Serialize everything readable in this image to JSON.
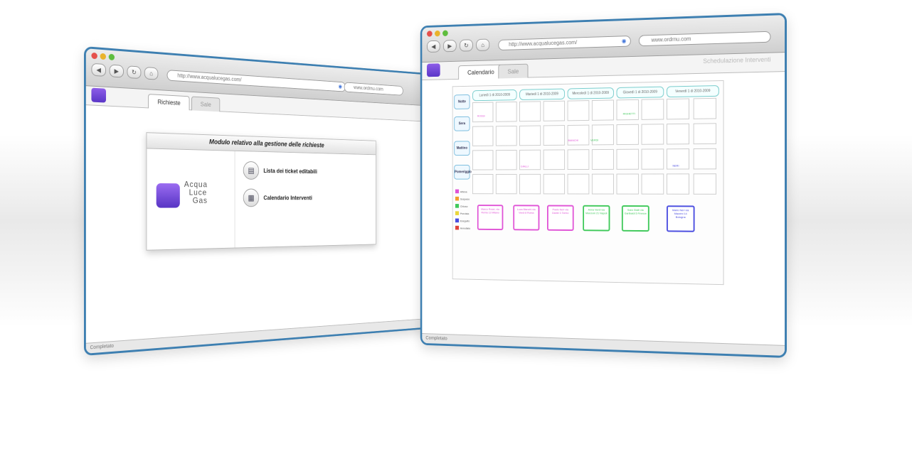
{
  "left_window": {
    "url": "http://www.acqualucegas.com/",
    "search": "www.ordrnu.com",
    "tabs": [
      "Richieste",
      "Sale"
    ],
    "card_title": "Modulo relativo alla gestione delle richieste",
    "brand_lines": [
      "Acqua",
      "Luce",
      "Gas"
    ],
    "menu": [
      {
        "label": "Lista dei ticket editabili",
        "icon": "list-icon"
      },
      {
        "label": "Calendario Interventi",
        "icon": "calendar-icon"
      }
    ],
    "status": "Completato"
  },
  "right_window": {
    "url": "http://www.acqualucegas.com/",
    "search": "www.ordrnu.com",
    "tabs": [
      "Calendario",
      "Sale"
    ],
    "header_title": "Schedulazione Interventi",
    "day_headers": [
      "Lunedì 1 di 2010-2009",
      "Martedì 1 di 2010-2009",
      "Mercoledì 1 di 2010-2009",
      "Giovedì 1 di 2010-2009",
      "Venerdì 1 di 2010-2009"
    ],
    "row_labels": [
      "Notte",
      "Sera",
      "Mattino",
      "Pomeriggio"
    ],
    "events": [
      "ROSSI",
      "RIGHETTI",
      "BIANCHI",
      "VERDI",
      "GIALLI",
      "NERI"
    ],
    "legend": [
      "Attesa",
      "Sospeso",
      "Chiuso",
      "Prevista",
      "Eseguito",
      "Annullato"
    ],
    "cards": [
      {
        "text": "Marco Rossi, via Roma 12 Milano",
        "color": "#e052d6"
      },
      {
        "text": "Luca Bianchi via Verdi 8 Roma",
        "color": "#e052d6"
      },
      {
        "text": "Paolo Neri via Dante 3 Torino",
        "color": "#e052d6"
      },
      {
        "text": "Anna Verdi via Manzoni 21 Napoli",
        "color": "#3fc95a"
      },
      {
        "text": "Sara Gialli via Garibaldi 5 Firenze",
        "color": "#3fc95a"
      },
      {
        "text": "Mario Neri via Mazzini 14 Bologna",
        "color": "#4a4de0"
      }
    ],
    "status": "Completato"
  }
}
